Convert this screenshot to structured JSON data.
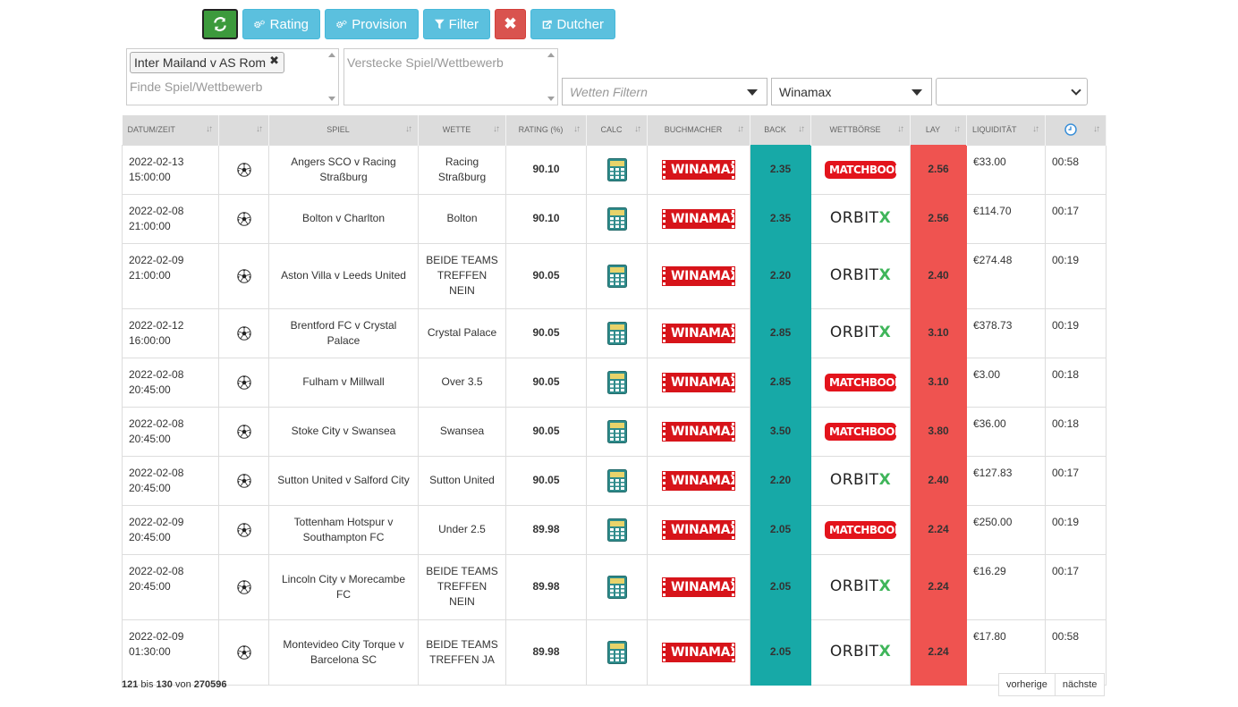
{
  "toolbar": {
    "rating_label": "Rating",
    "provision_label": "Provision",
    "filter_label": "Filter",
    "clear_label": "✖",
    "dutcher_label": "Dutcher"
  },
  "filters": {
    "find_chip": "Inter Mailand v AS Rom",
    "find_placeholder": "Finde Spiel/Wettbewerb",
    "hide_placeholder": "Verstecke Spiel/Wettbewerb",
    "bet_filter_placeholder": "Wetten Filtern",
    "bookmaker_selected": "Winamax",
    "other_selected": ""
  },
  "table": {
    "headers": [
      "DATUM/ZEIT",
      "",
      "SPIEL",
      "WETTE",
      "RATING (%)",
      "CALC",
      "BUCHMACHER",
      "BACK",
      "WETTBÖRSE",
      "LAY",
      "LIQUIDITÄT",
      ""
    ],
    "rows": [
      {
        "date": "2022-02-13",
        "time": "15:00:00",
        "match": "Angers SCO v Racing Straßburg",
        "bet": "Racing Straßburg",
        "rating": "90.10",
        "bookmaker": "WINAMAX",
        "back": "2.35",
        "exchange": "MATCHBOOK",
        "lay": "2.56",
        "liquidity": "€33.00",
        "age": "00:58"
      },
      {
        "date": "2022-02-08",
        "time": "21:00:00",
        "match": "Bolton v Charlton",
        "bet": "Bolton",
        "rating": "90.10",
        "bookmaker": "WINAMAX",
        "back": "2.35",
        "exchange": "ORBITX",
        "lay": "2.56",
        "liquidity": "€114.70",
        "age": "00:17"
      },
      {
        "date": "2022-02-09",
        "time": "21:00:00",
        "match": "Aston Villa v Leeds United",
        "bet": "BEIDE TEAMS TREFFEN NEIN",
        "rating": "90.05",
        "bookmaker": "WINAMAX",
        "back": "2.20",
        "exchange": "ORBITX",
        "lay": "2.40",
        "liquidity": "€274.48",
        "age": "00:19"
      },
      {
        "date": "2022-02-12",
        "time": "16:00:00",
        "match": "Brentford FC v Crystal Palace",
        "bet": "Crystal Palace",
        "rating": "90.05",
        "bookmaker": "WINAMAX",
        "back": "2.85",
        "exchange": "ORBITX",
        "lay": "3.10",
        "liquidity": "€378.73",
        "age": "00:19"
      },
      {
        "date": "2022-02-08",
        "time": "20:45:00",
        "match": "Fulham v Millwall",
        "bet": "Over 3.5",
        "rating": "90.05",
        "bookmaker": "WINAMAX",
        "back": "2.85",
        "exchange": "MATCHBOOK",
        "lay": "3.10",
        "liquidity": "€3.00",
        "age": "00:18"
      },
      {
        "date": "2022-02-08",
        "time": "20:45:00",
        "match": "Stoke City v Swansea",
        "bet": "Swansea",
        "rating": "90.05",
        "bookmaker": "WINAMAX",
        "back": "3.50",
        "exchange": "MATCHBOOK",
        "lay": "3.80",
        "liquidity": "€36.00",
        "age": "00:18"
      },
      {
        "date": "2022-02-08",
        "time": "20:45:00",
        "match": "Sutton United v Salford City",
        "bet": "Sutton United",
        "rating": "90.05",
        "bookmaker": "WINAMAX",
        "back": "2.20",
        "exchange": "ORBITX",
        "lay": "2.40",
        "liquidity": "€127.83",
        "age": "00:17"
      },
      {
        "date": "2022-02-09",
        "time": "20:45:00",
        "match": "Tottenham Hotspur v Southampton FC",
        "bet": "Under 2.5",
        "rating": "89.98",
        "bookmaker": "WINAMAX",
        "back": "2.05",
        "exchange": "MATCHBOOK",
        "lay": "2.24",
        "liquidity": "€250.00",
        "age": "00:19"
      },
      {
        "date": "2022-02-08",
        "time": "20:45:00",
        "match": "Lincoln City v Morecambe FC",
        "bet": "BEIDE TEAMS TREFFEN NEIN",
        "rating": "89.98",
        "bookmaker": "WINAMAX",
        "back": "2.05",
        "exchange": "ORBITX",
        "lay": "2.24",
        "liquidity": "€16.29",
        "age": "00:17"
      },
      {
        "date": "2022-02-09",
        "time": "01:30:00",
        "match": "Montevideo City Torque v Barcelona SC",
        "bet": "BEIDE TEAMS TREFFEN JA",
        "rating": "89.98",
        "bookmaker": "WINAMAX",
        "back": "2.05",
        "exchange": "ORBITX",
        "lay": "2.24",
        "liquidity": "€17.80",
        "age": "00:58"
      }
    ]
  },
  "pagination": {
    "from": "121",
    "sep1": "bis",
    "to": "130",
    "sep2": "von",
    "total": "270596",
    "prev_label": "vorherige",
    "next_label": "nächste"
  },
  "colors": {
    "back": "#17a9a7",
    "lay": "#ef5350",
    "refresh": "#3c9a3c",
    "info": "#5bc0de",
    "danger": "#d9534f"
  }
}
